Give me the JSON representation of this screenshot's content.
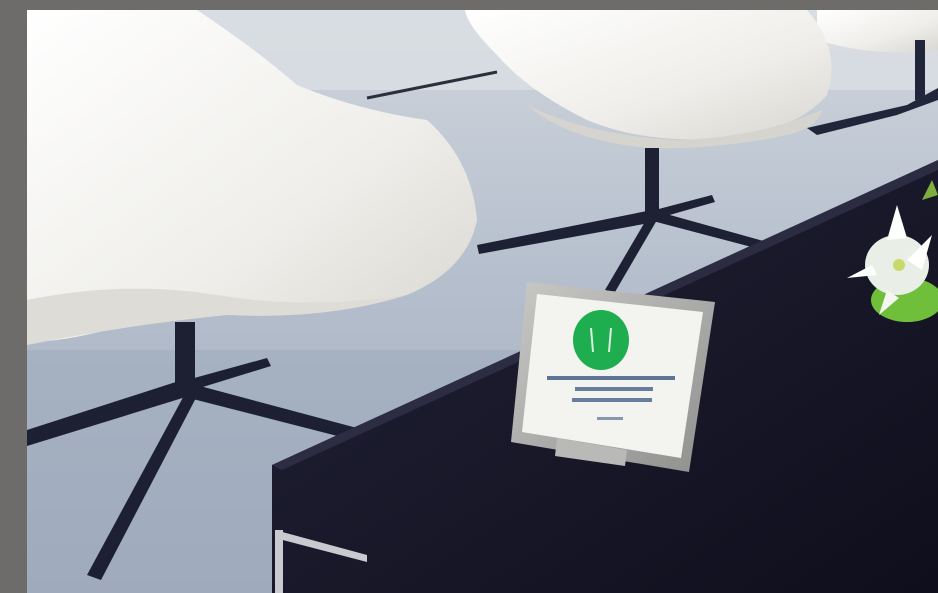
{
  "scene": {
    "subject": "photo",
    "colors": {
      "frame": "#6d6c6a",
      "table": "#17172a",
      "chair": "#f2f0ec",
      "sign_green": "#1fae4f",
      "floor": "#a9b5c8"
    }
  },
  "sign": {
    "lines": [
      "",
      "",
      "",
      ""
    ]
  }
}
